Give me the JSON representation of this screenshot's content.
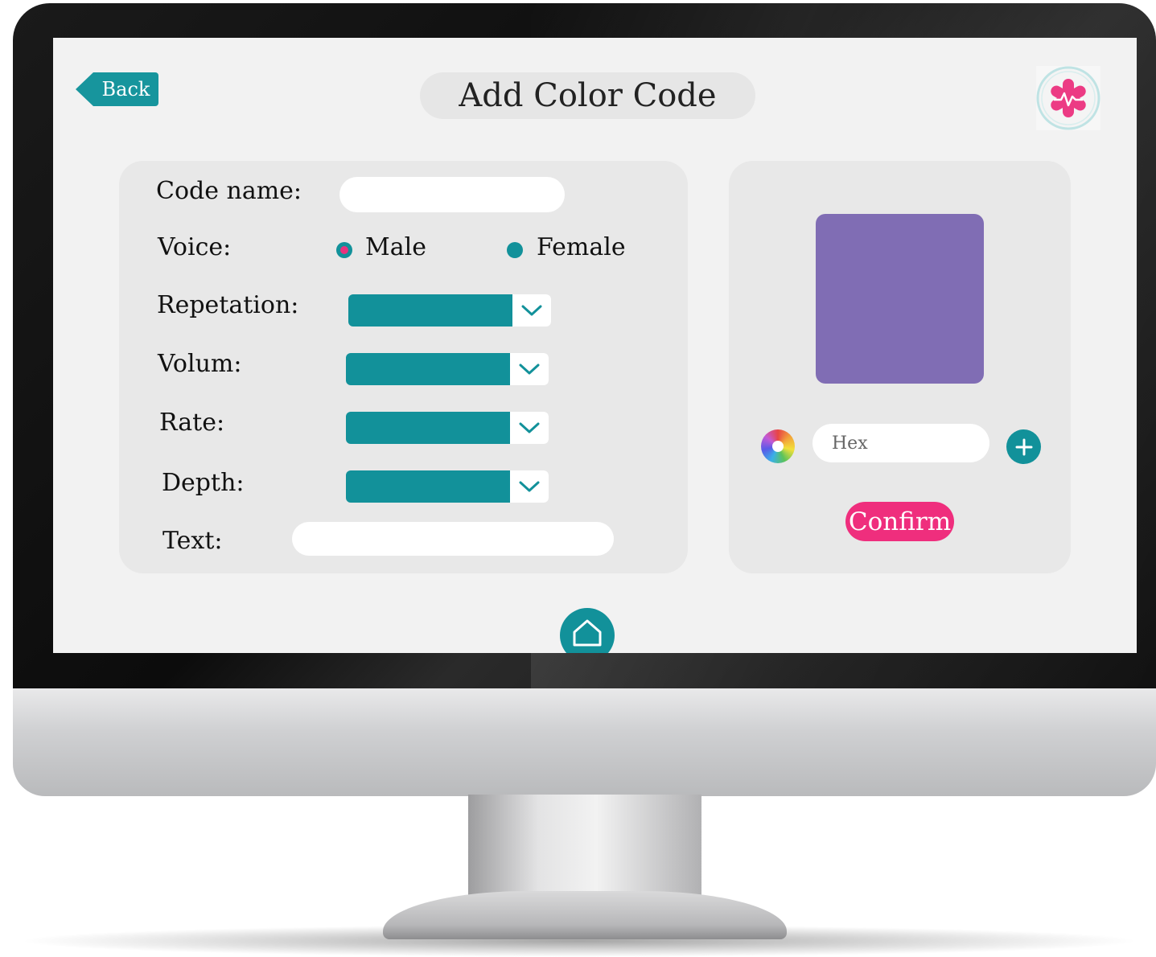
{
  "header": {
    "back_label": "Back",
    "title": "Add Color Code"
  },
  "form": {
    "code_name_label": "Code name:",
    "code_name_value": "",
    "voice_label": "Voice:",
    "voice_options": [
      "Male",
      "Female"
    ],
    "voice_selected": "Male",
    "repetition_label": "Repetation:",
    "volume_label": "Volum:",
    "rate_label": "Rate:",
    "depth_label": "Depth:",
    "text_label": "Text:",
    "text_value": ""
  },
  "color_panel": {
    "preview_color": "#806db4",
    "hex_placeholder": "Hex",
    "confirm_label": "Confirm"
  },
  "icons": {
    "logo": "medical-star-heartbeat-icon",
    "color_wheel": "color-wheel-icon",
    "add": "plus-icon",
    "home": "home-icon",
    "dropdown": "chevron-down-icon"
  },
  "colors": {
    "teal": "#12919a",
    "pink": "#ef2e7d",
    "purple": "#806db4",
    "screen_bg": "#f2f2f2",
    "card_bg": "#e8e8e8"
  }
}
